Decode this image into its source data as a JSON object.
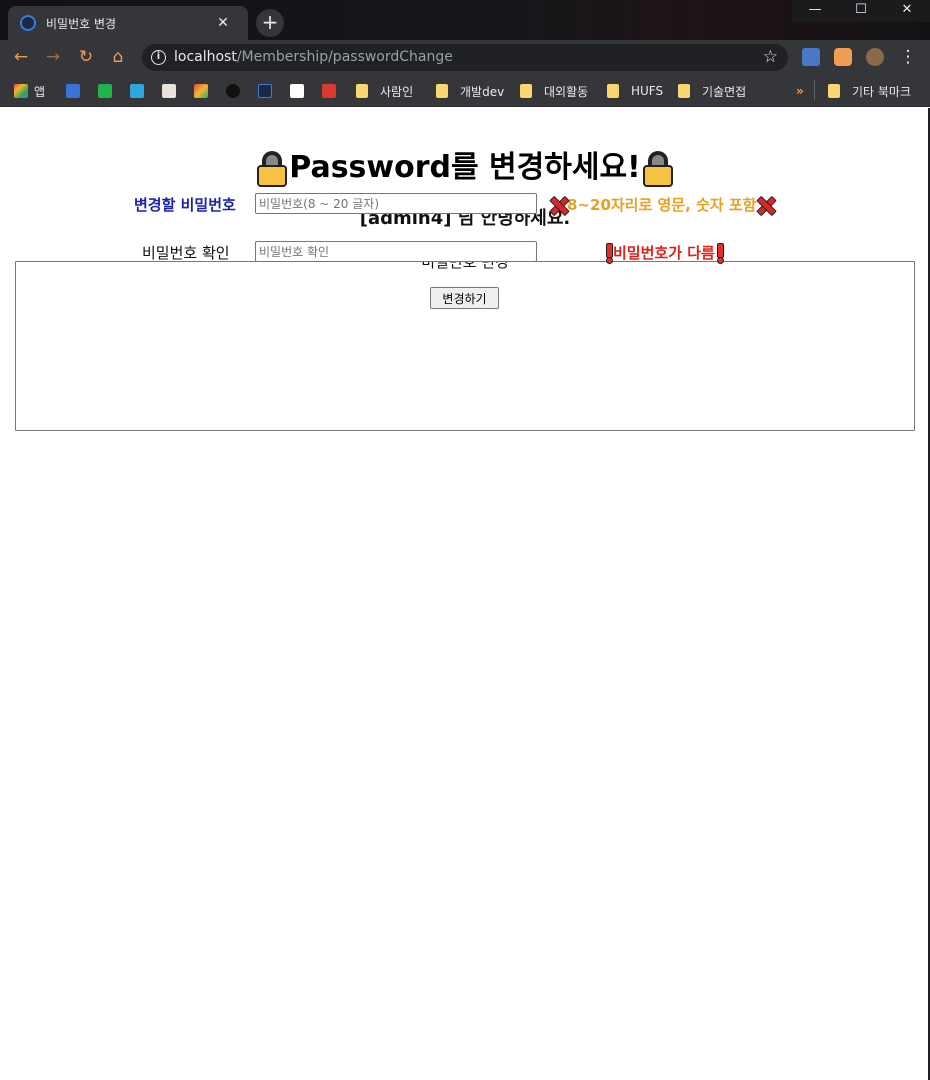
{
  "browser": {
    "tab_title": "비밀번호 변경",
    "tab_close": "✕",
    "new_tab": "+",
    "url_host": "localhost",
    "url_path": "/Membership/passwordChange",
    "bookmarks": {
      "apps": "앱",
      "items": [
        "사람인",
        "개발dev",
        "대외활동",
        "HUFS",
        "기술면접"
      ],
      "overflow": "»",
      "other": "기타 북마크"
    }
  },
  "page": {
    "heading": "Password를 변경하세요!",
    "greeting": "[admin4]  님 안녕하세요.",
    "fieldset_legend": "비밀번호 변경",
    "new_password": {
      "label": "변경할 비밀번호",
      "placeholder": "비밀번호(8 ~ 20 글자)",
      "value": "",
      "hint": "8~20자리로 영문, 숫자 포함"
    },
    "confirm_password": {
      "label": "비밀번호 확인",
      "placeholder": "비밀번호 확인",
      "value": "",
      "hint": "비밀번호가 다름"
    },
    "submit_label": "변경하기"
  },
  "colors": {
    "new_label": "#1a23b0",
    "rule_hint": "#e8a020",
    "mismatch_hint": "#e0201a",
    "browser_accent": "#f09c55"
  }
}
